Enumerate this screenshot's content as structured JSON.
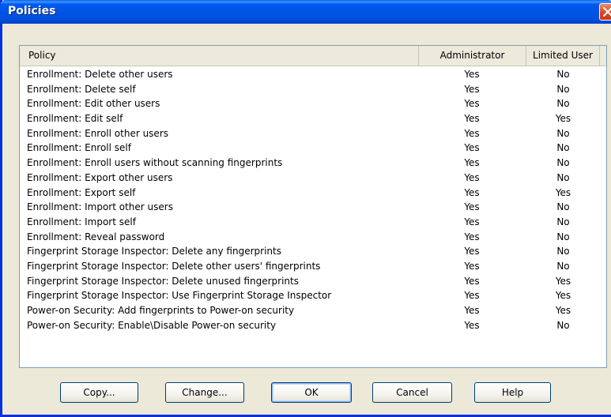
{
  "window": {
    "title": "Policies"
  },
  "table": {
    "headers": {
      "policy": "Policy",
      "admin": "Administrator",
      "limited": "Limited User"
    },
    "rows": [
      {
        "policy": "Enrollment: Delete other users",
        "admin": "Yes",
        "limited": "No"
      },
      {
        "policy": "Enrollment: Delete self",
        "admin": "Yes",
        "limited": "No"
      },
      {
        "policy": "Enrollment: Edit other users",
        "admin": "Yes",
        "limited": "No"
      },
      {
        "policy": "Enrollment: Edit self",
        "admin": "Yes",
        "limited": "Yes"
      },
      {
        "policy": "Enrollment: Enroll other users",
        "admin": "Yes",
        "limited": "No"
      },
      {
        "policy": "Enrollment: Enroll self",
        "admin": "Yes",
        "limited": "No"
      },
      {
        "policy": "Enrollment: Enroll users without scanning fingerprints",
        "admin": "Yes",
        "limited": "No"
      },
      {
        "policy": "Enrollment: Export other users",
        "admin": "Yes",
        "limited": "No"
      },
      {
        "policy": "Enrollment: Export self",
        "admin": "Yes",
        "limited": "Yes"
      },
      {
        "policy": "Enrollment: Import other users",
        "admin": "Yes",
        "limited": "No"
      },
      {
        "policy": "Enrollment: Import self",
        "admin": "Yes",
        "limited": "No"
      },
      {
        "policy": "Enrollment: Reveal password",
        "admin": "Yes",
        "limited": "No"
      },
      {
        "policy": "Fingerprint Storage Inspector: Delete any fingerprints",
        "admin": "Yes",
        "limited": "No"
      },
      {
        "policy": "Fingerprint Storage Inspector: Delete other users' fingerprints",
        "admin": "Yes",
        "limited": "No"
      },
      {
        "policy": "Fingerprint Storage Inspector: Delete unused fingerprints",
        "admin": "Yes",
        "limited": "Yes"
      },
      {
        "policy": "Fingerprint Storage Inspector: Use Fingerprint Storage Inspector",
        "admin": "Yes",
        "limited": "Yes"
      },
      {
        "policy": "Power-on Security: Add fingerprints to Power-on security",
        "admin": "Yes",
        "limited": "Yes"
      },
      {
        "policy": "Power-on Security: Enable\\Disable Power-on security",
        "admin": "Yes",
        "limited": "No"
      }
    ]
  },
  "buttons": {
    "copy": "Copy...",
    "change": "Change...",
    "ok": "OK",
    "cancel": "Cancel",
    "help": "Help"
  },
  "icons": {
    "close": "close-icon"
  }
}
